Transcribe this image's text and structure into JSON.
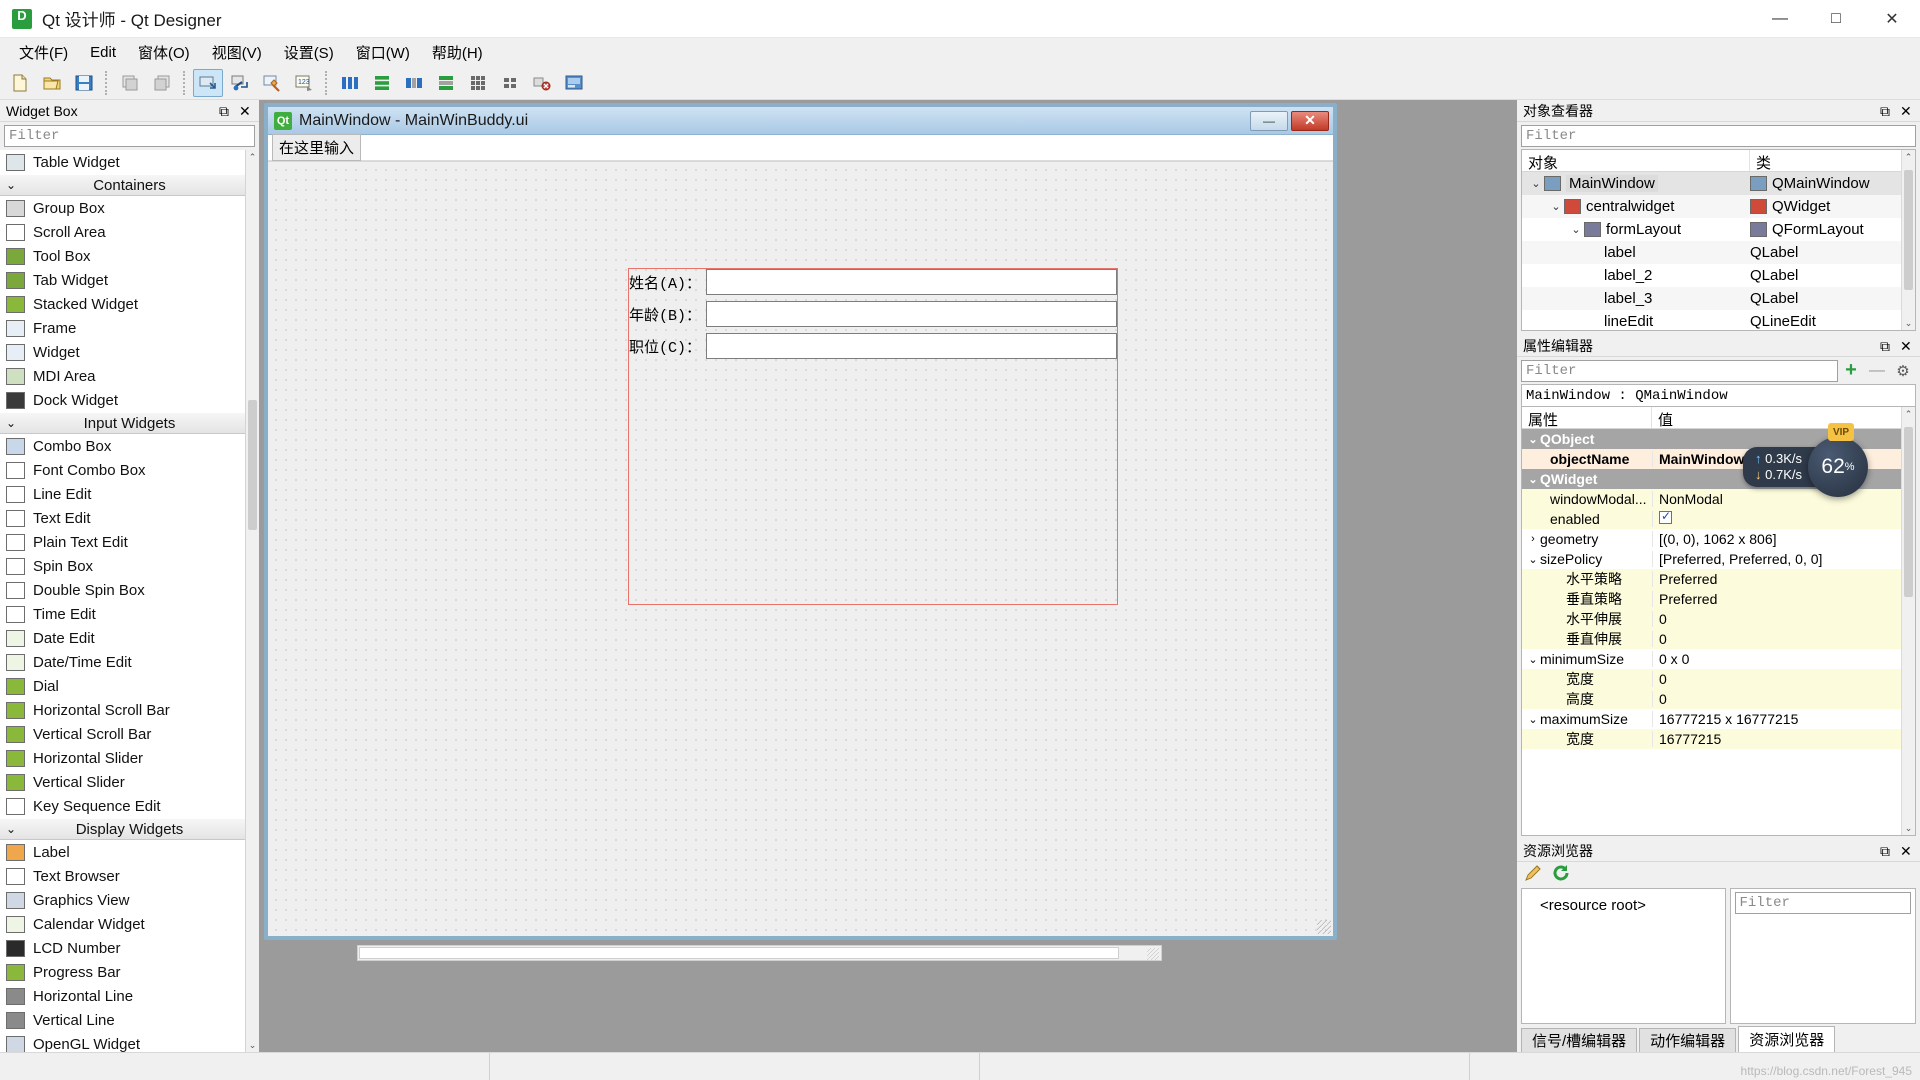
{
  "window": {
    "app_icon": "designer-icon",
    "title": "Qt 设计师 - Qt Designer",
    "minimize": "—",
    "maximize": "□",
    "close": "✕"
  },
  "menubar": {
    "items": [
      {
        "label": "文件(F)",
        "name": "menu-file"
      },
      {
        "label": "Edit",
        "name": "menu-edit"
      },
      {
        "label": "窗体(O)",
        "name": "menu-form"
      },
      {
        "label": "视图(V)",
        "name": "menu-view"
      },
      {
        "label": "设置(S)",
        "name": "menu-settings"
      },
      {
        "label": "窗口(W)",
        "name": "menu-window"
      },
      {
        "label": "帮助(H)",
        "name": "menu-help"
      }
    ]
  },
  "toolbar": {
    "buttons": [
      {
        "name": "new-form-icon",
        "tip": "新建"
      },
      {
        "name": "open-folder-icon",
        "tip": "打开"
      },
      {
        "name": "save-icon",
        "tip": "保存"
      },
      {
        "name": "undo-icon",
        "tip": "撤销"
      },
      {
        "name": "redo-icon",
        "tip": "重做"
      },
      {
        "name": "edit-widgets-icon",
        "tip": "编辑控件"
      },
      {
        "name": "edit-signals-slots-icon",
        "tip": "编辑信号/槽"
      },
      {
        "name": "edit-buddies-icon",
        "tip": "编辑伙伴"
      },
      {
        "name": "edit-tab-order-icon",
        "tip": "编辑Tab顺序"
      },
      {
        "name": "layout-horizontally-icon",
        "tip": "水平布局"
      },
      {
        "name": "layout-vertically-icon",
        "tip": "垂直布局"
      },
      {
        "name": "layout-splitter-h-icon",
        "tip": "水平拆分器布局"
      },
      {
        "name": "layout-splitter-v-icon",
        "tip": "垂直拆分器布局"
      },
      {
        "name": "layout-grid-icon",
        "tip": "栅格布局"
      },
      {
        "name": "layout-form-icon",
        "tip": "表单布局"
      },
      {
        "name": "break-layout-icon",
        "tip": "打破布局"
      },
      {
        "name": "adjust-size-icon",
        "tip": "调整大小"
      }
    ]
  },
  "widget_box": {
    "panel_title": "Widget Box",
    "float_button": "⧉",
    "close_button": "✕",
    "filter_placeholder": "Filter",
    "scroll_up": "⌃",
    "scroll_down": "⌄",
    "items": [
      {
        "type": "item",
        "label": "Table Widget",
        "icon": "table-widget-icon"
      },
      {
        "type": "category",
        "label": "Containers",
        "icon": "chevron-down-icon"
      },
      {
        "type": "item",
        "label": "Group Box",
        "icon": "group-box-icon"
      },
      {
        "type": "item",
        "label": "Scroll Area",
        "icon": "scroll-area-icon"
      },
      {
        "type": "item",
        "label": "Tool Box",
        "icon": "tool-box-icon"
      },
      {
        "type": "item",
        "label": "Tab Widget",
        "icon": "tab-widget-icon"
      },
      {
        "type": "item",
        "label": "Stacked Widget",
        "icon": "stacked-widget-icon"
      },
      {
        "type": "item",
        "label": "Frame",
        "icon": "frame-icon"
      },
      {
        "type": "item",
        "label": "Widget",
        "icon": "widget-icon"
      },
      {
        "type": "item",
        "label": "MDI Area",
        "icon": "mdi-area-icon"
      },
      {
        "type": "item",
        "label": "Dock Widget",
        "icon": "dock-widget-icon"
      },
      {
        "type": "category",
        "label": "Input Widgets",
        "icon": "chevron-down-icon"
      },
      {
        "type": "item",
        "label": "Combo Box",
        "icon": "combo-box-icon"
      },
      {
        "type": "item",
        "label": "Font Combo Box",
        "icon": "font-combo-box-icon"
      },
      {
        "type": "item",
        "label": "Line Edit",
        "icon": "line-edit-icon"
      },
      {
        "type": "item",
        "label": "Text Edit",
        "icon": "text-edit-icon"
      },
      {
        "type": "item",
        "label": "Plain Text Edit",
        "icon": "plain-text-edit-icon"
      },
      {
        "type": "item",
        "label": "Spin Box",
        "icon": "spin-box-icon"
      },
      {
        "type": "item",
        "label": "Double Spin Box",
        "icon": "double-spin-box-icon"
      },
      {
        "type": "item",
        "label": "Time Edit",
        "icon": "time-edit-icon"
      },
      {
        "type": "item",
        "label": "Date Edit",
        "icon": "date-edit-icon"
      },
      {
        "type": "item",
        "label": "Date/Time Edit",
        "icon": "date-time-edit-icon"
      },
      {
        "type": "item",
        "label": "Dial",
        "icon": "dial-icon"
      },
      {
        "type": "item",
        "label": "Horizontal Scroll Bar",
        "icon": "horizontal-scroll-bar-icon"
      },
      {
        "type": "item",
        "label": "Vertical Scroll Bar",
        "icon": "vertical-scroll-bar-icon"
      },
      {
        "type": "item",
        "label": "Horizontal Slider",
        "icon": "horizontal-slider-icon"
      },
      {
        "type": "item",
        "label": "Vertical Slider",
        "icon": "vertical-slider-icon"
      },
      {
        "type": "item",
        "label": "Key Sequence Edit",
        "icon": "key-sequence-edit-icon"
      },
      {
        "type": "category",
        "label": "Display Widgets",
        "icon": "chevron-down-icon"
      },
      {
        "type": "item",
        "label": "Label",
        "icon": "label-icon"
      },
      {
        "type": "item",
        "label": "Text Browser",
        "icon": "text-browser-icon"
      },
      {
        "type": "item",
        "label": "Graphics View",
        "icon": "graphics-view-icon"
      },
      {
        "type": "item",
        "label": "Calendar Widget",
        "icon": "calendar-widget-icon"
      },
      {
        "type": "item",
        "label": "LCD Number",
        "icon": "lcd-number-icon"
      },
      {
        "type": "item",
        "label": "Progress Bar",
        "icon": "progress-bar-icon"
      },
      {
        "type": "item",
        "label": "Horizontal Line",
        "icon": "horizontal-line-icon"
      },
      {
        "type": "item",
        "label": "Vertical Line",
        "icon": "vertical-line-icon"
      },
      {
        "type": "item",
        "label": "OpenGL Widget",
        "icon": "opengl-widget-icon"
      }
    ]
  },
  "designer_form": {
    "window_title": "MainWindow - MainWinBuddy.ui",
    "icon": "qt-icon",
    "minimize": "—",
    "close": "✕",
    "menu_placeholder": "在这里输入",
    "form_rows": [
      {
        "label": "姓名(A)：",
        "value": ""
      },
      {
        "label": "年龄(B)：",
        "value": ""
      },
      {
        "label": "职位(C)：",
        "value": ""
      }
    ]
  },
  "object_inspector": {
    "panel_title": "对象查看器",
    "float_button": "⧉",
    "close_button": "✕",
    "filter_placeholder": "Filter",
    "columns": [
      "对象",
      "类"
    ],
    "scroll_up": "⌃",
    "scroll_down": "⌄",
    "rows": [
      {
        "name": "MainWindow",
        "cls": "QMainWindow",
        "indent": 0,
        "expanded": true,
        "icon": "mainwindow-icon",
        "selected": true
      },
      {
        "name": "centralwidget",
        "cls": "QWidget",
        "indent": 1,
        "expanded": true,
        "icon": "centralwidget-icon",
        "selected": false
      },
      {
        "name": "formLayout",
        "cls": "QFormLayout",
        "indent": 2,
        "expanded": true,
        "icon": "formlayout-icon",
        "selected": false
      },
      {
        "name": "label",
        "cls": "QLabel",
        "indent": 3,
        "expanded": false,
        "icon": "",
        "selected": false
      },
      {
        "name": "label_2",
        "cls": "QLabel",
        "indent": 3,
        "expanded": false,
        "icon": "",
        "selected": false
      },
      {
        "name": "label_3",
        "cls": "QLabel",
        "indent": 3,
        "expanded": false,
        "icon": "",
        "selected": false
      },
      {
        "name": "lineEdit",
        "cls": "QLineEdit",
        "indent": 3,
        "expanded": false,
        "icon": "",
        "selected": false
      }
    ]
  },
  "property_editor": {
    "panel_title": "属性编辑器",
    "float_button": "⧉",
    "close_button": "✕",
    "filter_placeholder": "Filter",
    "add_button": "+",
    "remove_button": "—",
    "config_button": "⚙",
    "object_line": "MainWindow : QMainWindow",
    "columns": [
      "属性",
      "值"
    ],
    "scroll_up": "⌃",
    "scroll_down": "⌄",
    "rows": [
      {
        "key": "QObject",
        "value": "",
        "style": "group",
        "expander": "⌄",
        "indent": 0
      },
      {
        "key": "objectName",
        "value": "MainWindow",
        "style": "orange",
        "expander": "",
        "indent": 1
      },
      {
        "key": "QWidget",
        "value": "",
        "style": "group",
        "expander": "⌄",
        "indent": 0
      },
      {
        "key": "windowModal...",
        "value": "NonModal",
        "style": "yellow",
        "expander": "",
        "indent": 1
      },
      {
        "key": "enabled",
        "value": "",
        "style": "yellow",
        "expander": "",
        "indent": 1,
        "checkbox": true
      },
      {
        "key": "geometry",
        "value": "[(0, 0), 1062 x 806]",
        "style": "plain",
        "expander": "›",
        "indent": 0
      },
      {
        "key": "sizePolicy",
        "value": "[Preferred, Preferred, 0, 0]",
        "style": "plain",
        "expander": "⌄",
        "indent": 0
      },
      {
        "key": "水平策略",
        "value": "Preferred",
        "style": "yellow",
        "expander": "",
        "indent": 2
      },
      {
        "key": "垂直策略",
        "value": "Preferred",
        "style": "yellow",
        "expander": "",
        "indent": 2
      },
      {
        "key": "水平伸展",
        "value": "0",
        "style": "yellow",
        "expander": "",
        "indent": 2
      },
      {
        "key": "垂直伸展",
        "value": "0",
        "style": "yellow",
        "expander": "",
        "indent": 2
      },
      {
        "key": "minimumSize",
        "value": "0 x 0",
        "style": "plain",
        "expander": "⌄",
        "indent": 0
      },
      {
        "key": "宽度",
        "value": "0",
        "style": "yellow",
        "expander": "",
        "indent": 2
      },
      {
        "key": "高度",
        "value": "0",
        "style": "yellow",
        "expander": "",
        "indent": 2
      },
      {
        "key": "maximumSize",
        "value": "16777215 x 16777215",
        "style": "plain",
        "expander": "⌄",
        "indent": 0
      },
      {
        "key": "宽度",
        "value": "16777215",
        "style": "yellow",
        "expander": "",
        "indent": 2
      }
    ]
  },
  "resource_browser": {
    "panel_title": "资源浏览器",
    "float_button": "⧉",
    "close_button": "✕",
    "edit_button": "edit-pencil-icon",
    "reload_button": "reload-icon",
    "root_label": "<resource root>",
    "filter_placeholder": "Filter",
    "tabs": [
      {
        "label": "信号/槽编辑器",
        "active": false
      },
      {
        "label": "动作编辑器",
        "active": false
      },
      {
        "label": "资源浏览器",
        "active": true
      }
    ]
  },
  "overlay": {
    "upload_speed": "0.3K/s",
    "download_speed": "0.7K/s",
    "percent": "62",
    "percent_unit": "%",
    "badge": "VIP",
    "up_arrow": "↑",
    "down_arrow": "↓"
  },
  "watermark": {
    "text": "https://blog.csdn.net/Forest_945"
  },
  "colors": {
    "accent": "#cde6f7",
    "selection_red": "#e8736a",
    "group_bg": "#a5a5a5",
    "yellow_row": "#fcfbdc",
    "orange_row": "#fdeedd",
    "canvas": "#9b9b9b"
  }
}
